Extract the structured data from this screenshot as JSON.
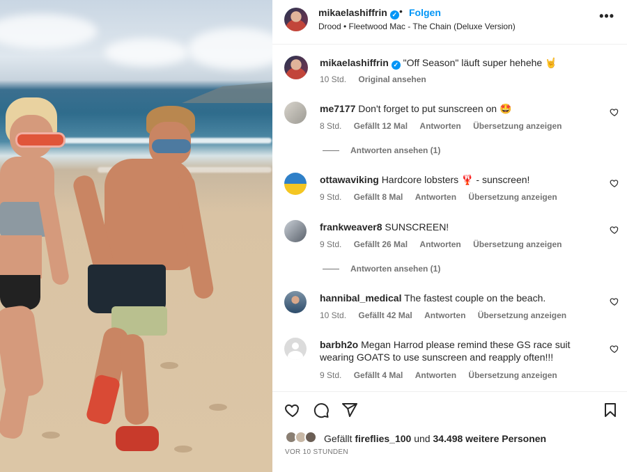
{
  "header": {
    "username": "mikaelashiffrin",
    "dot": "•",
    "follow_label": "Folgen",
    "song": "Drood • Fleetwood Mac - The Chain (Deluxe Version)",
    "more_label": "•••"
  },
  "caption": {
    "username": "mikaelashiffrin",
    "text": "\"Off Season\" läuft super hehehe 🤘",
    "time": "10 Std.",
    "see_original": "Original ansehen"
  },
  "comments": [
    {
      "username": "me7177",
      "text": "Don't forget to put sunscreen on 🤩",
      "time": "8 Std.",
      "likes": "Gefällt 12 Mal",
      "reply": "Antworten",
      "translate": "Übersetzung anzeigen",
      "replies": "Antworten ansehen (1)"
    },
    {
      "username": "ottawaviking",
      "text": "Hardcore lobsters 🦞 - sunscreen!",
      "time": "9 Std.",
      "likes": "Gefällt 8 Mal",
      "reply": "Antworten",
      "translate": "Übersetzung anzeigen"
    },
    {
      "username": "frankweaver8",
      "text": "SUNSCREEN!",
      "time": "9 Std.",
      "likes": "Gefällt 26 Mal",
      "reply": "Antworten",
      "translate": "Übersetzung anzeigen",
      "replies": "Antworten ansehen (1)"
    },
    {
      "username": "hannibal_medical",
      "text": "The fastest couple on the beach.",
      "time": "10 Std.",
      "likes": "Gefällt 42 Mal",
      "reply": "Antworten",
      "translate": "Übersetzung anzeigen"
    },
    {
      "username": "barbh2o",
      "text": "Megan Harrod please remind these GS race suit wearing GOATS to use sunscreen and reapply often!!!",
      "time": "9 Std.",
      "likes": "Gefällt 4 Mal",
      "reply": "Antworten",
      "translate": "Übersetzung anzeigen"
    }
  ],
  "likes_summary": {
    "prefix": "Gefällt",
    "user": "fireflies_100",
    "middle": "und",
    "count": "34.498 weitere Personen"
  },
  "post_time": "VOR 10 STUNDEN",
  "icons": {
    "like": "heart-icon",
    "comment": "comment-icon",
    "share": "share-icon",
    "save": "bookmark-icon",
    "verified": "verified-badge-icon",
    "more": "more-options-icon"
  },
  "colors": {
    "link_blue": "#0095f6",
    "text": "#262626",
    "secondary": "#737373",
    "divider": "#efefef"
  }
}
